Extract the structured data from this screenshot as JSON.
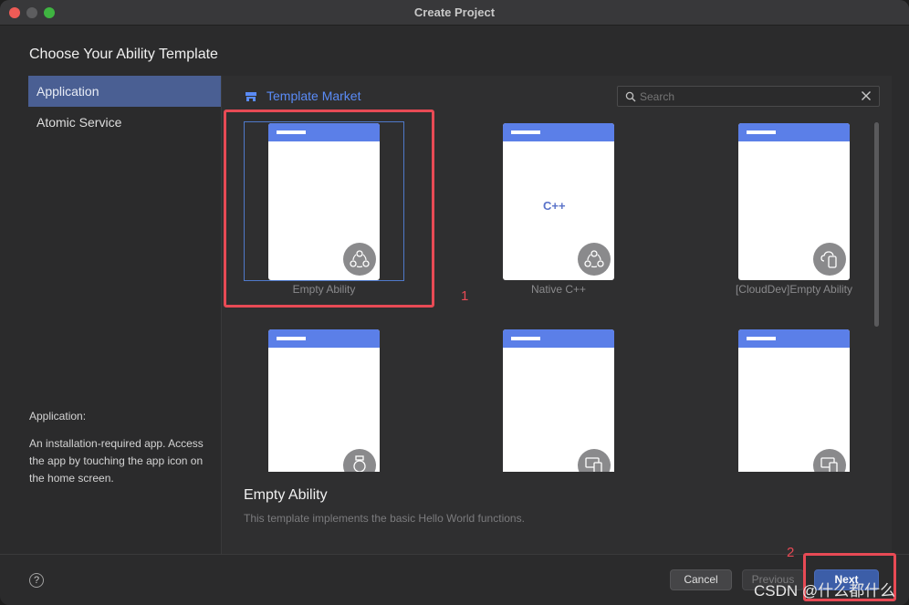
{
  "window": {
    "title": "Create Project"
  },
  "heading": "Choose Your Ability Template",
  "sidebar": {
    "items": [
      {
        "label": "Application",
        "active": true
      },
      {
        "label": "Atomic Service",
        "active": false
      }
    ],
    "description_title": "Application:",
    "description": "An installation-required app. Access the app by touching the app icon on the home screen."
  },
  "market": {
    "label": "Template Market",
    "icon": "store-icon"
  },
  "search": {
    "placeholder": "Search",
    "value": ""
  },
  "templates": [
    {
      "label": "Empty Ability",
      "icon": "shared-nodes-icon",
      "selected": true
    },
    {
      "label": "Native C++",
      "icon": "shared-nodes-icon",
      "selected": false
    },
    {
      "label": "[CloudDev]Empty Ability",
      "icon": "cloud-phone-icon",
      "selected": false
    },
    {
      "label": "",
      "icon": "watch-icon",
      "selected": false
    },
    {
      "label": "",
      "icon": "devices-icon",
      "selected": false
    },
    {
      "label": "",
      "icon": "devices-icon",
      "selected": false
    }
  ],
  "cpp_glyph": "C++",
  "selected_template": {
    "title": "Empty Ability",
    "description": "This template implements the basic Hello World functions."
  },
  "footer": {
    "help": "?",
    "cancel_label": "Cancel",
    "previous_label": "Previous",
    "next_label": "Next"
  },
  "annotations": {
    "one": "1",
    "two": "2"
  },
  "watermark": "CSDN @什么都什么",
  "colors": {
    "accent": "#5a8bf6",
    "selection": "#4a5f93",
    "annotation": "#e84a55",
    "phone_bar": "#5b7fe8"
  }
}
